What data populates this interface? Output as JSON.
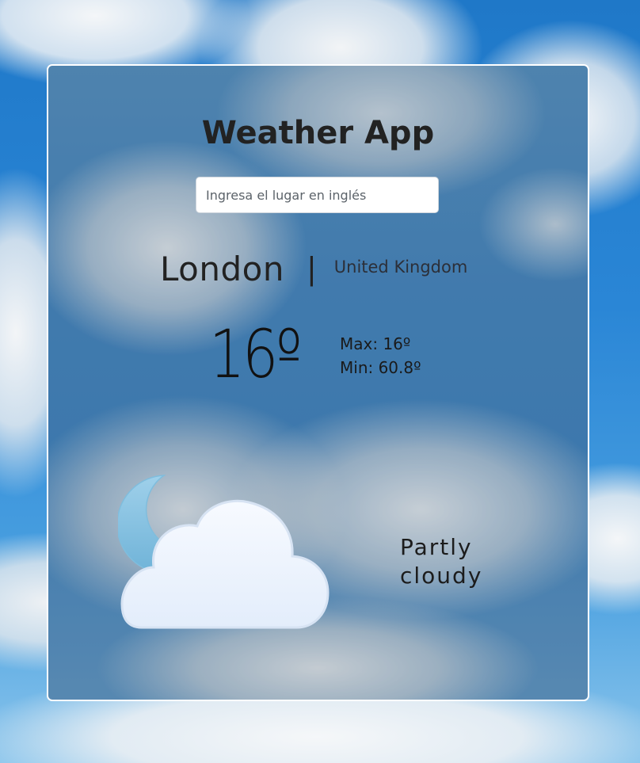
{
  "app": {
    "title": "Weather App"
  },
  "search": {
    "placeholder": "Ingresa el lugar en inglés",
    "value": ""
  },
  "location": {
    "city": "London",
    "separator": "|",
    "country": "United Kingdom"
  },
  "temperature": {
    "current": "16º",
    "max_label": "Max: 16º",
    "min_label": "Min: 60.8º"
  },
  "condition": {
    "text": "Partly cloudy",
    "icon": "partly-cloudy-night-icon"
  },
  "colors": {
    "panel_border": "#ffffff",
    "text_dark": "#222222",
    "moon": "#8ac4e0",
    "cloud": "#eef4fd"
  }
}
